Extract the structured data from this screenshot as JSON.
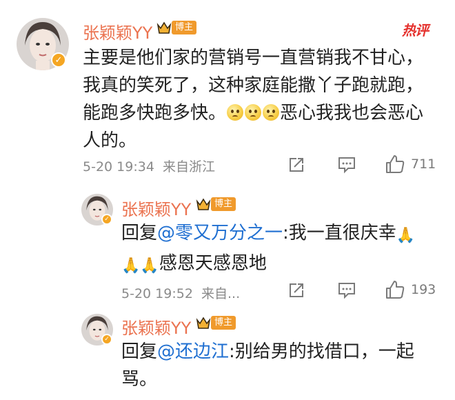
{
  "hot_tag": "热评",
  "comment": {
    "username": "张颖颖YY",
    "badge": "博主",
    "text_before_emoji": "主要是他们家的营销号一直营销我不甘心，我真的笑死了，这种家庭能撒丫子跑就跑，能跑多快跑多快。",
    "emoji_names": [
      "pitiful-face",
      "pitiful-face",
      "pitiful-face"
    ],
    "text_after_emoji": "恶心我我也会恶心人的。",
    "timestamp": "5-20 19:34",
    "location": "来自浙江",
    "like_count": "711"
  },
  "replies": [
    {
      "username": "张颖颖YY",
      "badge": "博主",
      "reply_prefix": "回复",
      "mention": "@零又万分之一",
      "text_part1": ":我一直很庆幸",
      "text_part2": "感恩天感恩地",
      "timestamp": "5-20 19:52",
      "location": "来自...",
      "like_count": "193"
    },
    {
      "username": "张颖颖YY",
      "badge": "博主",
      "reply_prefix": "回复",
      "mention": "@还边江",
      "text_part1": ":别给男的找借口，一起骂。"
    }
  ],
  "colors": {
    "username": "#eb7350",
    "mention": "#1f6fd1",
    "badge": "#f09a2c",
    "hot": "#e5322e"
  }
}
